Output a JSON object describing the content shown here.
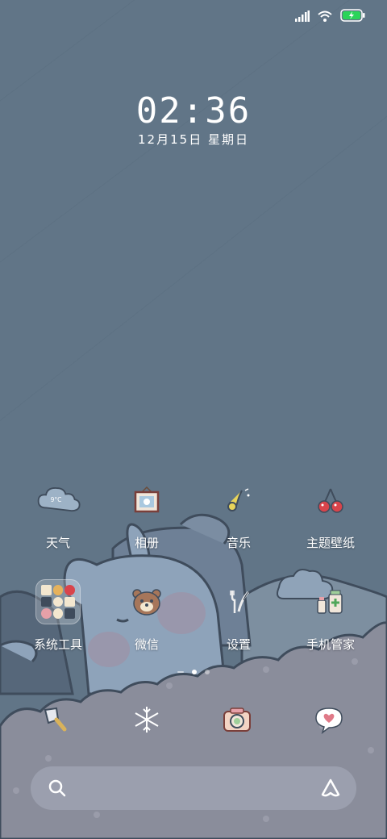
{
  "status_bar": {
    "signal_icon": "signal-bars-icon",
    "wifi_icon": "wifi-icon",
    "battery_icon": "battery-charging-icon",
    "battery_color": "#2bd45a"
  },
  "lock_clock": {
    "time": "02:36",
    "date": "12月15日 星期日"
  },
  "apps_row1": [
    {
      "label": "天气",
      "icon": "weather-cloud-icon",
      "temp": "9°C"
    },
    {
      "label": "相册",
      "icon": "photo-frame-icon"
    },
    {
      "label": "音乐",
      "icon": "saxophone-icon"
    },
    {
      "label": "主题壁纸",
      "icon": "cherries-icon"
    }
  ],
  "apps_row2": [
    {
      "label": "系统工具",
      "icon": "folder-icon"
    },
    {
      "label": "微信",
      "icon": "bear-face-icon"
    },
    {
      "label": "设置",
      "icon": "fork-knife-icon"
    },
    {
      "label": "手机管家",
      "icon": "medicine-bottles-icon"
    }
  ],
  "dock": [
    {
      "icon": "cleaver-icon"
    },
    {
      "icon": "snowflake-icon"
    },
    {
      "icon": "camera-icon"
    },
    {
      "icon": "heart-bubble-icon"
    }
  ],
  "page_indicator": {
    "pages": 3,
    "current": 2
  },
  "search_bar": {
    "left_icon": "search-icon",
    "right_icon": "assistant-icon"
  },
  "colors": {
    "background": "#617587",
    "bunny": "#8ea3ba",
    "cloud_ground": "#8a8d9b"
  }
}
